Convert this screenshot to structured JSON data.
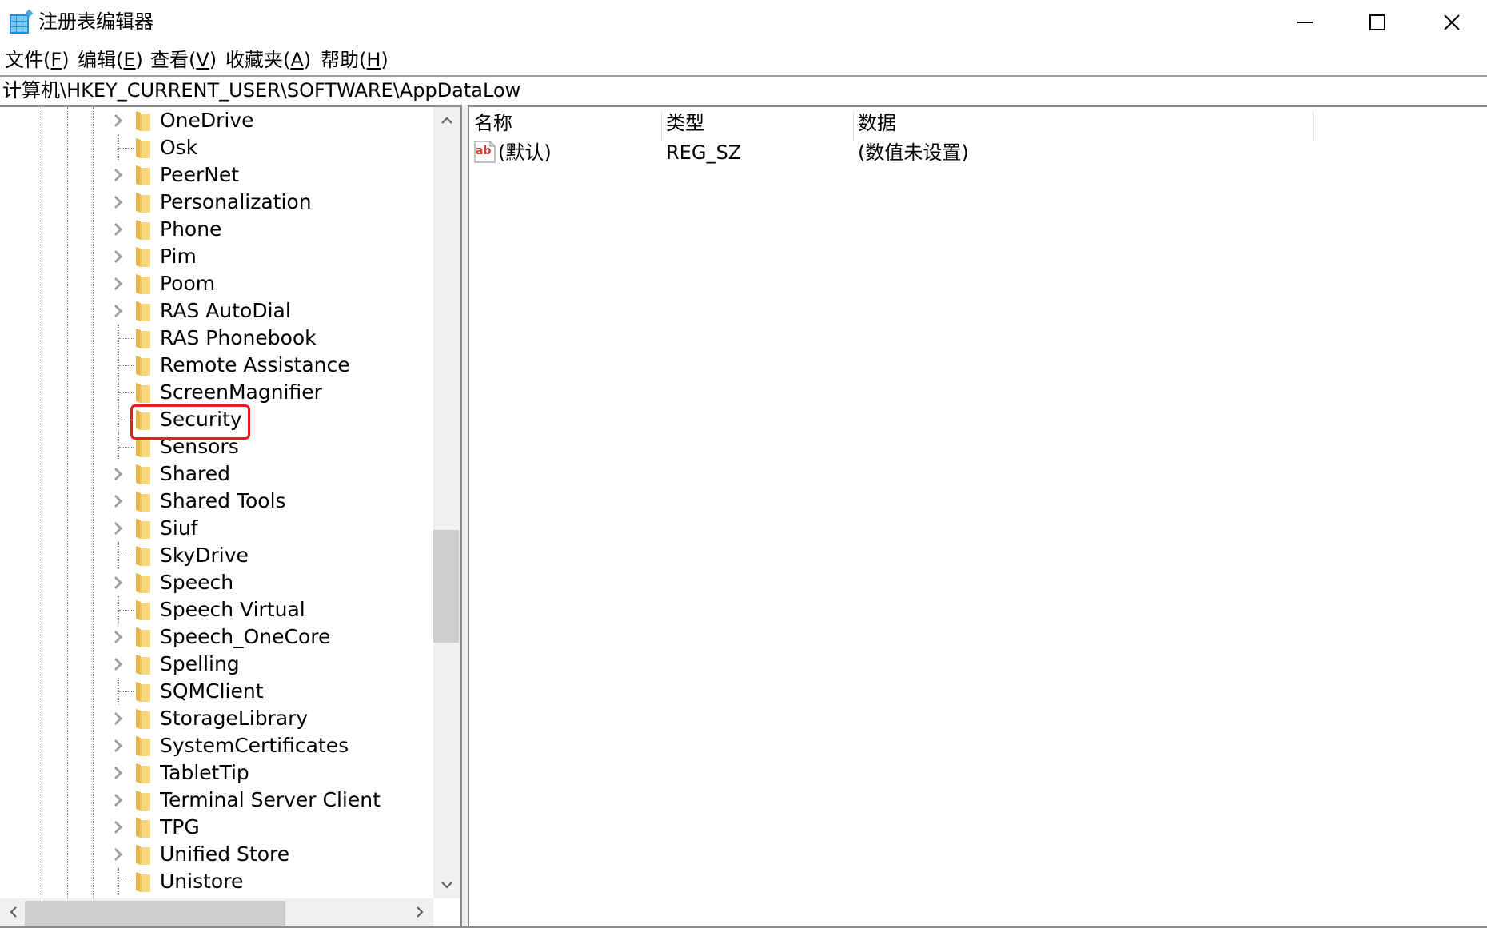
{
  "window": {
    "title": "注册表编辑器",
    "icon": "registry-editor-icon",
    "controls": [
      "minimize-icon",
      "maximize-icon",
      "close-icon"
    ]
  },
  "menu": {
    "items": [
      {
        "label": "文件(",
        "key": "F",
        "suffix": ")"
      },
      {
        "label": "编辑(",
        "key": "E",
        "suffix": ")"
      },
      {
        "label": "查看(",
        "key": "V",
        "suffix": ")"
      },
      {
        "label": "收藏夹(",
        "key": "A",
        "suffix": ")"
      },
      {
        "label": "帮助(",
        "key": "H",
        "suffix": ")"
      }
    ]
  },
  "address": {
    "path": "计算机\\HKEY_CURRENT_USER\\SOFTWARE\\AppDataLow"
  },
  "tree": {
    "highlighted": "Security",
    "highlight_color": "#ee1b1b",
    "items": [
      {
        "label": "OneDrive",
        "expandable": true
      },
      {
        "label": "Osk",
        "expandable": false
      },
      {
        "label": "PeerNet",
        "expandable": true
      },
      {
        "label": "Personalization",
        "expandable": true
      },
      {
        "label": "Phone",
        "expandable": true
      },
      {
        "label": "Pim",
        "expandable": true
      },
      {
        "label": "Poom",
        "expandable": true
      },
      {
        "label": "RAS AutoDial",
        "expandable": true
      },
      {
        "label": "RAS Phonebook",
        "expandable": false
      },
      {
        "label": "Remote Assistance",
        "expandable": false
      },
      {
        "label": "ScreenMagnifier",
        "expandable": false
      },
      {
        "label": "Security",
        "expandable": false
      },
      {
        "label": "Sensors",
        "expandable": false
      },
      {
        "label": "Shared",
        "expandable": true
      },
      {
        "label": "Shared Tools",
        "expandable": true
      },
      {
        "label": "Siuf",
        "expandable": true
      },
      {
        "label": "SkyDrive",
        "expandable": false
      },
      {
        "label": "Speech",
        "expandable": true
      },
      {
        "label": "Speech Virtual",
        "expandable": false
      },
      {
        "label": "Speech_OneCore",
        "expandable": true
      },
      {
        "label": "Spelling",
        "expandable": true
      },
      {
        "label": "SQMClient",
        "expandable": false
      },
      {
        "label": "StorageLibrary",
        "expandable": true
      },
      {
        "label": "SystemCertificates",
        "expandable": true
      },
      {
        "label": "TabletTip",
        "expandable": true
      },
      {
        "label": "Terminal Server Client",
        "expandable": true
      },
      {
        "label": "TPG",
        "expandable": true
      },
      {
        "label": "Unified Store",
        "expandable": true
      },
      {
        "label": "Unistore",
        "expandable": false
      }
    ]
  },
  "scrollbars": {
    "vertical": {
      "position_fraction": 0.55
    },
    "horizontal": {
      "position_fraction": 0.0
    }
  },
  "list": {
    "columns": [
      "名称",
      "类型",
      "数据"
    ],
    "rows": [
      {
        "icon": "string-value-icon",
        "name": "(默认)",
        "type": "REG_SZ",
        "data": "(数值未设置)"
      }
    ]
  }
}
